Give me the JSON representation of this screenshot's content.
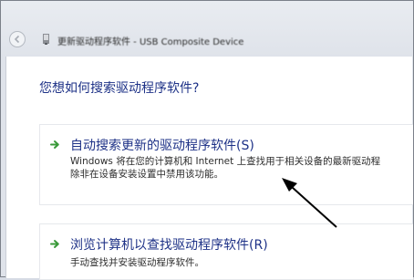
{
  "window": {
    "title": "更新驱动程序软件 - USB Composite Device",
    "back_icon": "back-arrow-icon",
    "device_icon": "usb-device-icon"
  },
  "main": {
    "question": "您想如何搜索驱动程序软件?",
    "options": [
      {
        "title": "自动搜索更新的驱动程序软件(S)",
        "desc_line1": "Windows 将在您的计算机和 Internet 上查找用于相关设备的最新驱动程",
        "desc_line2": "除非在设备安装设置中禁用该功能。",
        "icon": "green-arrow-icon"
      },
      {
        "title": "浏览计算机以查找驱动程序软件(R)",
        "desc_line1": "手动查找并安装驱动程序软件。",
        "icon": "green-arrow-icon"
      }
    ]
  },
  "colors": {
    "link_blue": "#1e3287",
    "arrow_green": "#3a9a3a",
    "annotation": "#000000"
  }
}
